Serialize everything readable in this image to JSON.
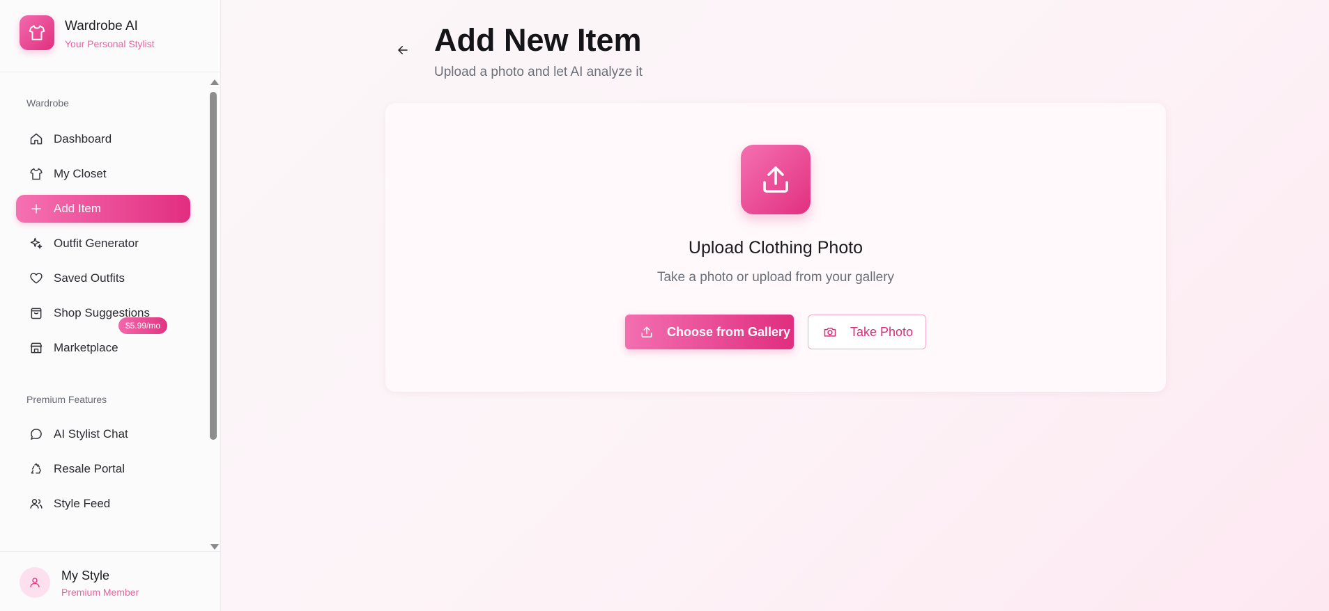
{
  "brand": {
    "title": "Wardrobe AI",
    "subtitle": "Your Personal Stylist",
    "logo_icon": "shirt-icon"
  },
  "sidebar": {
    "sections": [
      {
        "label": "Wardrobe",
        "items": [
          {
            "label": "Dashboard",
            "icon": "home-icon",
            "active": false
          },
          {
            "label": "My Closet",
            "icon": "shirt-icon",
            "active": false
          },
          {
            "label": "Add Item",
            "icon": "plus-icon",
            "active": true
          },
          {
            "label": "Outfit Generator",
            "icon": "sparkles-icon",
            "active": false
          },
          {
            "label": "Saved Outfits",
            "icon": "heart-icon",
            "active": false
          },
          {
            "label": "Shop Suggestions",
            "icon": "shopping-bag-icon",
            "active": false
          },
          {
            "label": "Marketplace",
            "icon": "store-icon",
            "active": false
          }
        ]
      },
      {
        "label": "Premium Features",
        "badge": "$5.99/mo",
        "items": [
          {
            "label": "AI Stylist Chat",
            "icon": "chat-bubble-icon",
            "active": false
          },
          {
            "label": "Resale Portal",
            "icon": "recycle-icon",
            "active": false
          },
          {
            "label": "Style Feed",
            "icon": "users-icon",
            "active": false
          }
        ]
      }
    ]
  },
  "profile": {
    "name": "My Style",
    "role": "Premium Member",
    "avatar_icon": "user-icon"
  },
  "main": {
    "title": "Add New Item",
    "subtitle": "Upload a photo and let AI analyze it",
    "back_icon": "arrow-left-icon",
    "upload_card": {
      "icon": "upload-icon",
      "title": "Upload Clothing Photo",
      "subtitle": "Take a photo or upload from your gallery",
      "gallery_button": "Choose from Gallery",
      "photo_button": "Take Photo"
    }
  },
  "colors": {
    "accent": "#e2307f",
    "accent_light": "#f571b2",
    "muted_text": "#6b6f78"
  }
}
